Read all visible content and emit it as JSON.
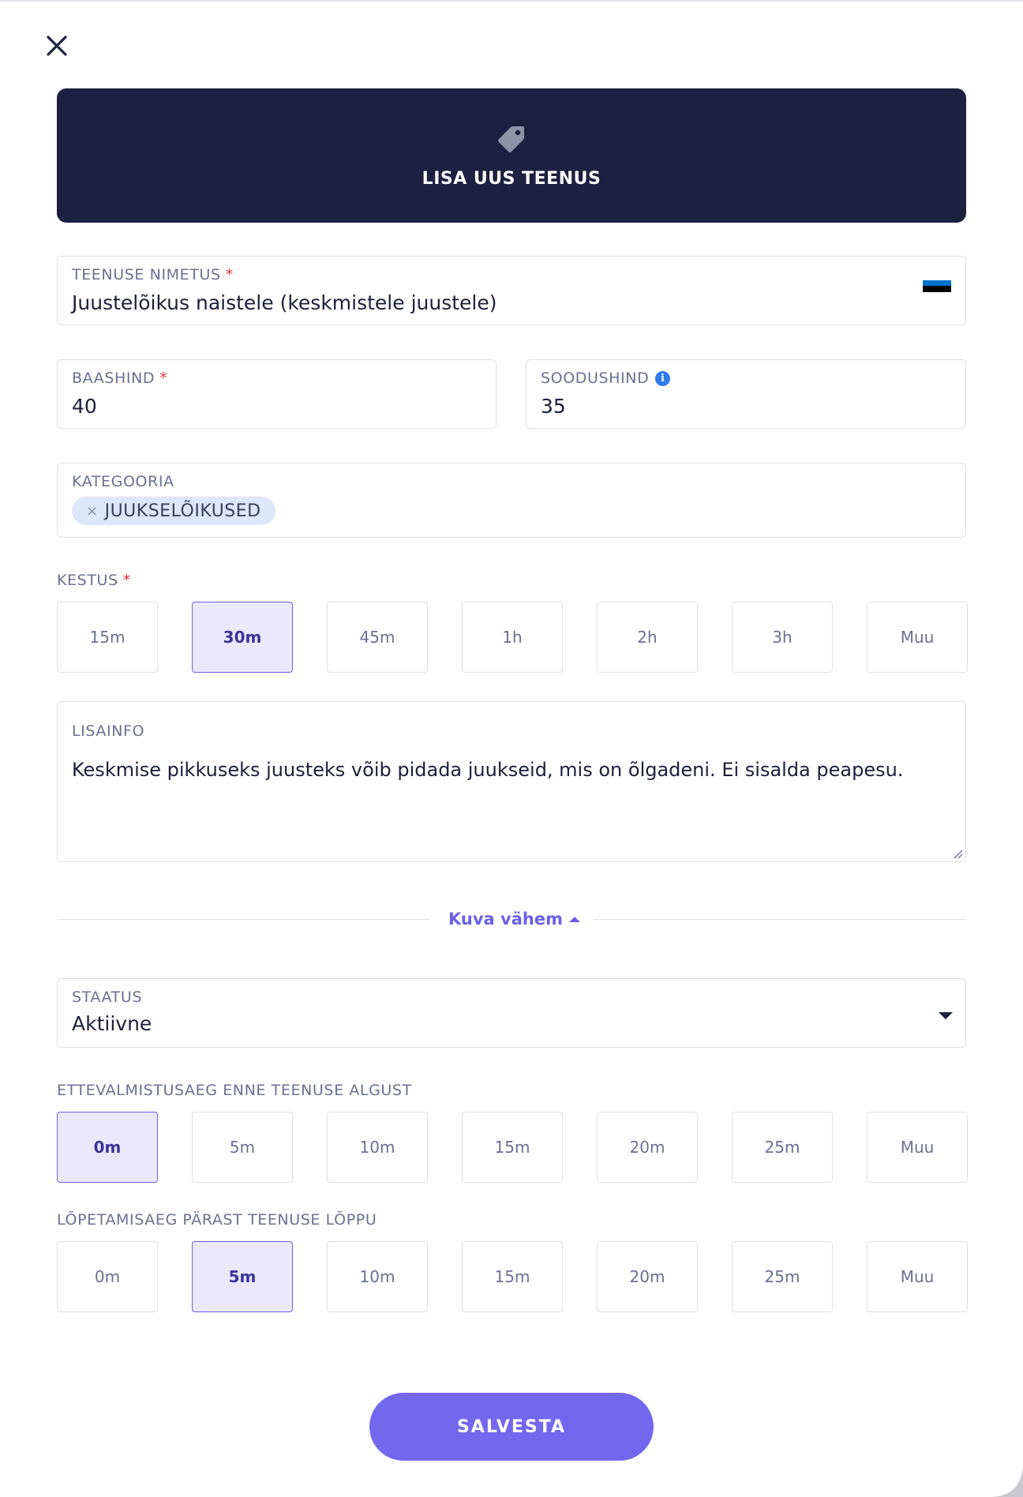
{
  "header": {
    "title": "LISA UUS TEENUS"
  },
  "name_field": {
    "label": "TEENUSE NIMETUS",
    "required_mark": "*",
    "value": "Juustelõikus naistele (keskmistele juustele)",
    "flag_colors": [
      "#0072ce",
      "#000000",
      "#ffffff"
    ]
  },
  "base_price": {
    "label": "BAASHIND",
    "required_mark": "*",
    "value": "40"
  },
  "sale_price": {
    "label": "SOODUSHIND",
    "info_icon": "i",
    "value": "35"
  },
  "category": {
    "label": "KATEGOORIA",
    "chip_remove": "×",
    "chip_label": "JUUKSELÕIKUSED"
  },
  "duration": {
    "label": "KESTUS",
    "required_mark": "*",
    "options": [
      "15m",
      "30m",
      "45m",
      "1h",
      "2h",
      "3h",
      "Muu"
    ],
    "selected": "30m"
  },
  "notes": {
    "label": "LISAINFO",
    "value": "Keskmise pikkuseks juusteks võib pidada  juukseid, mis on õlgadeni. Ei sisalda peapesu."
  },
  "toggle": {
    "label": "Kuva vähem"
  },
  "status": {
    "label": "STAATUS",
    "value": "Aktiivne"
  },
  "prep_time": {
    "label": "ETTEVALMISTUSAEG ENNE TEENUSE ALGUST",
    "options": [
      "0m",
      "5m",
      "10m",
      "15m",
      "20m",
      "25m",
      "Muu"
    ],
    "selected": "0m"
  },
  "finish_time": {
    "label": "LÕPETAMISAEG PÄRAST TEENUSE LÕPPU",
    "options": [
      "0m",
      "5m",
      "10m",
      "15m",
      "20m",
      "25m",
      "Muu"
    ],
    "selected": "5m"
  },
  "save_button": {
    "label": "SALVESTA"
  },
  "colors": {
    "accent": "#7367ee",
    "hero_bg": "#1d2040",
    "selected_bg": "#ebe8fc",
    "required": "#e0323f"
  }
}
